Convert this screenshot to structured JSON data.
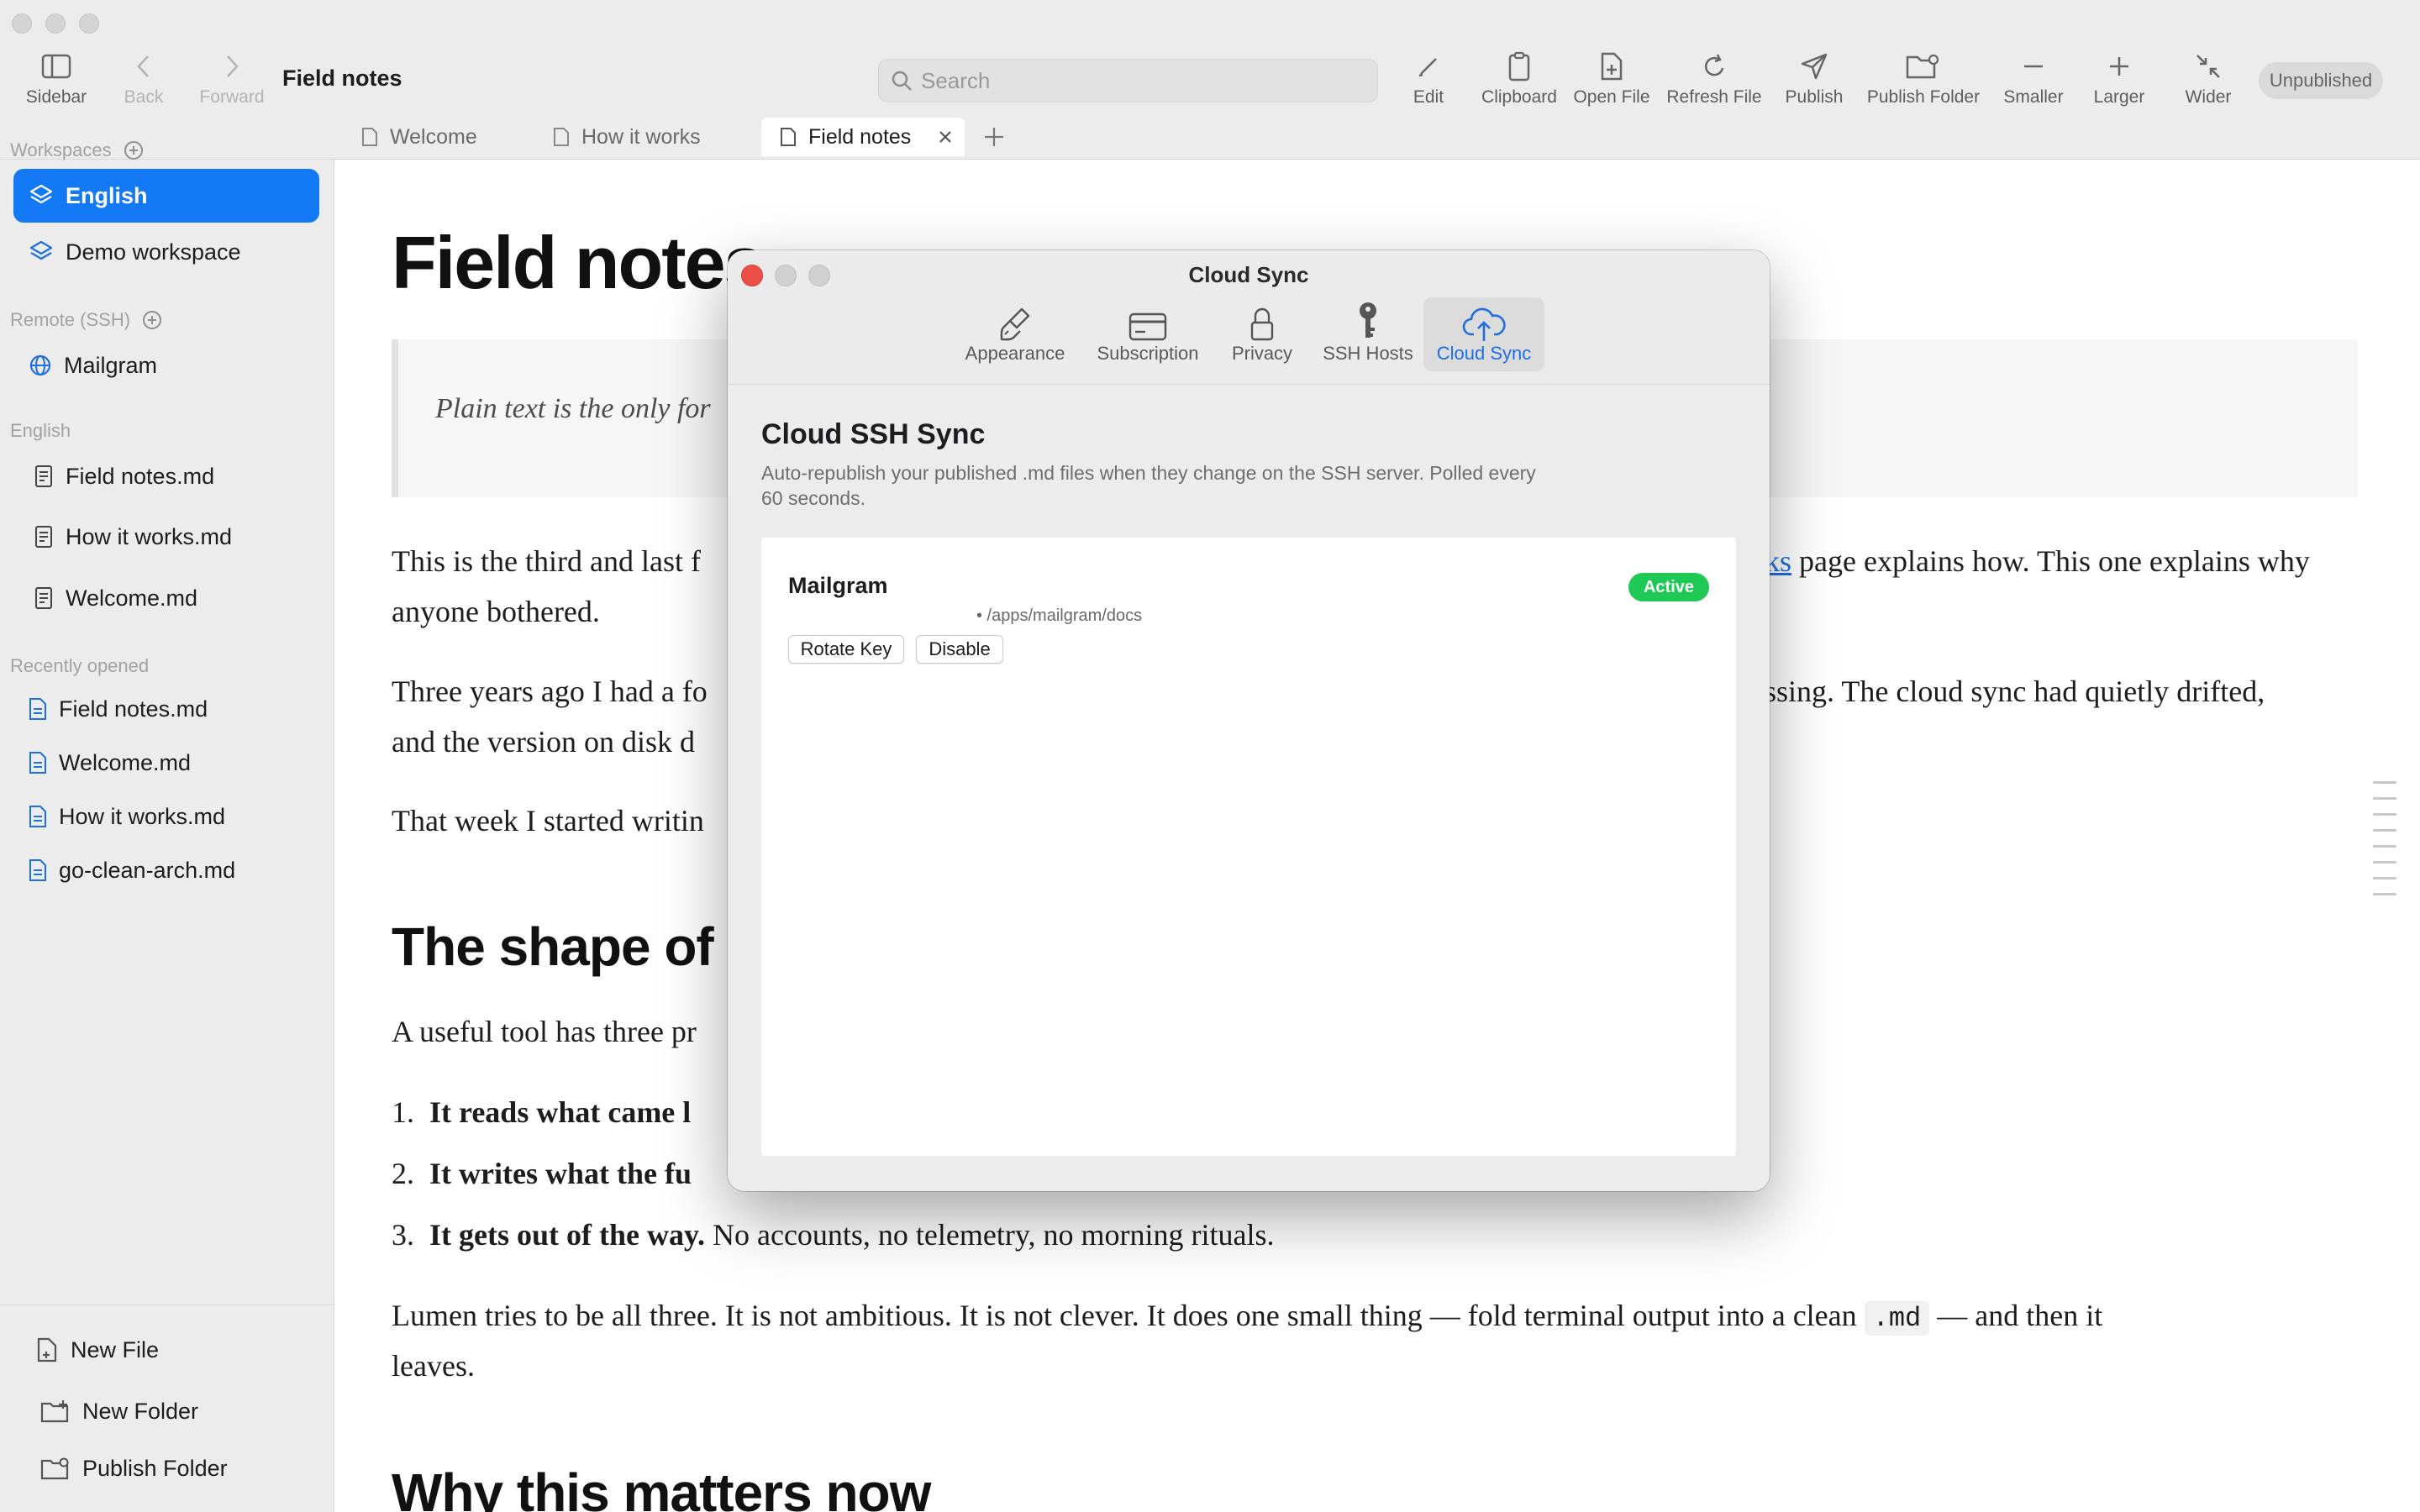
{
  "toolbar": {
    "sidebar_label": "Sidebar",
    "back_label": "Back",
    "forward_label": "Forward",
    "document_title": "Field notes",
    "search_placeholder": "Search",
    "edit_label": "Edit",
    "clipboard_label": "Clipboard",
    "open_file_label": "Open File",
    "refresh_file_label": "Refresh File",
    "publish_label": "Publish",
    "publish_folder_label": "Publish Folder",
    "smaller_label": "Smaller",
    "larger_label": "Larger",
    "wider_label": "Wider",
    "status_badge": "Unpublished"
  },
  "tabs": [
    {
      "label": "Welcome"
    },
    {
      "label": "How it works"
    },
    {
      "label": "Field notes",
      "active": true
    }
  ],
  "sidebar": {
    "workspaces_heading": "Workspaces",
    "workspaces": [
      {
        "label": "English",
        "selected": true
      },
      {
        "label": "Demo workspace"
      }
    ],
    "remote_heading": "Remote (SSH)",
    "remotes": [
      {
        "label": "Mailgram"
      }
    ],
    "folder_heading": "English",
    "files": [
      {
        "label": "Field notes.md"
      },
      {
        "label": "How it works.md"
      },
      {
        "label": "Welcome.md"
      }
    ],
    "recent_heading": "Recently opened",
    "recent": [
      {
        "label": "Field notes.md"
      },
      {
        "label": "Welcome.md"
      },
      {
        "label": "How it works.md"
      },
      {
        "label": "go-clean-arch.md"
      }
    ],
    "bottom": {
      "new_file": "New File",
      "new_folder": "New Folder",
      "publish_folder": "Publish Folder"
    }
  },
  "document": {
    "title": "Field notes",
    "quote": "Plain text is the only for",
    "p1_a": "This is the third and last f",
    "p1_link": "ks",
    "p1_b": " page explains how. This one explains why",
    "p1_c": "anyone bothered.",
    "p2_a": "Three years ago I had a fo",
    "p2_b": "issing. The cloud sync had quietly drifted,",
    "p2_c": "and the version on disk d",
    "p3": "That week I started writin",
    "h2_shape": "The shape of u",
    "p4": "A useful tool has three pr",
    "li1_num": "1.",
    "li1_bold": "It reads what came l",
    "li2_num": "2.",
    "li2_bold": "It writes what the fu",
    "li3_num": "3.",
    "li3_bold": "It gets out of the way.",
    "li3_rest": " No accounts, no telemetry, no morning rituals.",
    "p5_a": "Lumen tries to be all three. It is not ambitious. It is not clever. It does one small thing — fold terminal output into a clean ",
    "p5_code": ".md",
    "p5_b": " — and then it",
    "p5_c": "leaves.",
    "h2_why": "Why this matters now"
  },
  "dialog": {
    "title": "Cloud Sync",
    "tabs": [
      {
        "label": "Appearance"
      },
      {
        "label": "Subscription"
      },
      {
        "label": "Privacy"
      },
      {
        "label": "SSH Hosts"
      },
      {
        "label": "Cloud Sync",
        "selected": true
      }
    ],
    "heading": "Cloud SSH Sync",
    "description_line1": "Auto-republish your published .md files when they change on the SSH server. Polled every",
    "description_line2": "60 seconds.",
    "host": {
      "name": "Mailgram",
      "path": "• /apps/mailgram/docs",
      "status": "Active",
      "rotate_key": "Rotate Key",
      "disable": "Disable"
    }
  },
  "colors": {
    "accent": "#1479f5",
    "active_green": "#1ec955",
    "close_red": "#ed4e48"
  }
}
